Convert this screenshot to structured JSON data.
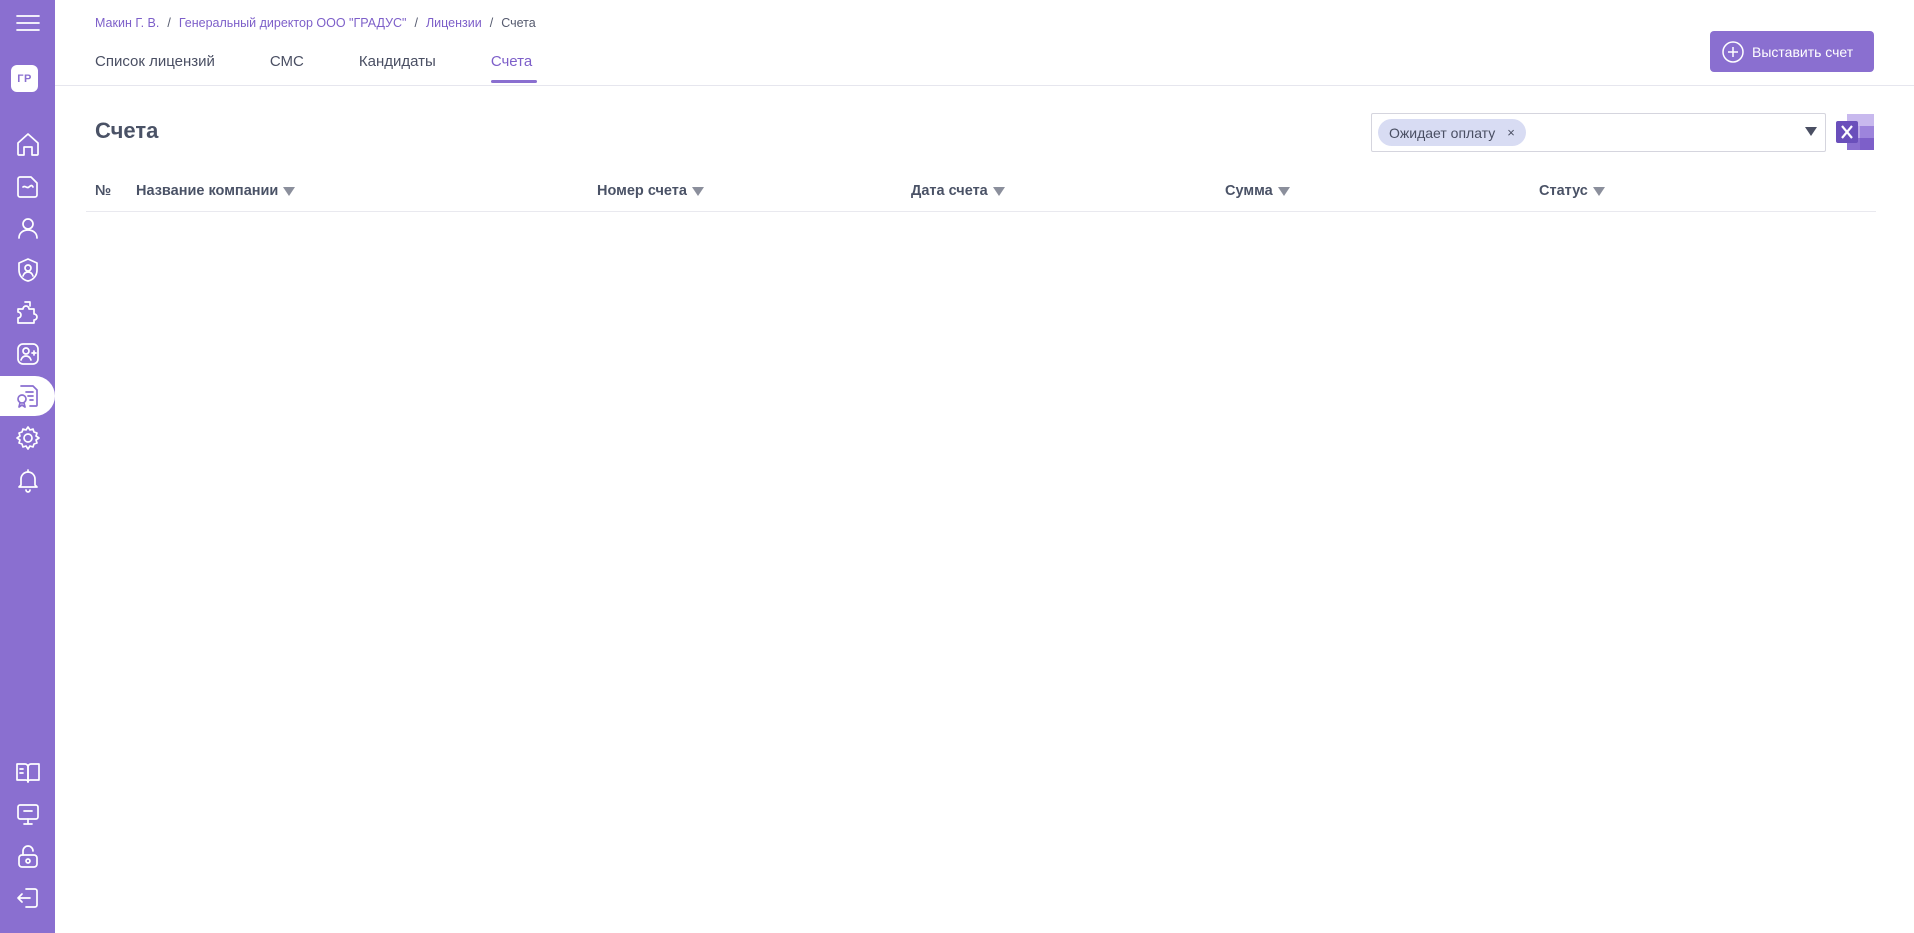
{
  "sidebar": {
    "avatar": "ГР",
    "top_items": [
      {
        "icon": "home-icon"
      },
      {
        "icon": "document-icon"
      },
      {
        "icon": "user-icon"
      },
      {
        "icon": "user-shield-icon"
      },
      {
        "icon": "puzzle-icon"
      },
      {
        "icon": "user-add-icon"
      },
      {
        "icon": "license-icon",
        "active": true
      },
      {
        "icon": "gear-icon"
      },
      {
        "icon": "bell-icon"
      }
    ],
    "bottom_items": [
      {
        "icon": "book-icon"
      },
      {
        "icon": "monitor-chat-icon"
      },
      {
        "icon": "unlock-icon"
      },
      {
        "icon": "logout-icon"
      }
    ]
  },
  "breadcrumb": {
    "items": [
      "Макин Г. В.",
      "Генеральный директор ООО \"ГРАДУС\"",
      "Лицензии",
      "Счета"
    ]
  },
  "tabs": [
    "Список лицензий",
    "СМС",
    "Кандидаты",
    "Счета"
  ],
  "active_tab": "Счета",
  "header": {
    "create_button_label": "Выставить счет"
  },
  "main": {
    "title": "Счета",
    "filter": {
      "selected_chip": "Ожидает оплату",
      "chip_remove": "×"
    },
    "export_icon": "excel-icon",
    "table": {
      "columns": [
        "№",
        "Название компании",
        "Номер счета",
        "Дата счета",
        "Сумма",
        "Статус"
      ],
      "rows": []
    }
  },
  "colors": {
    "accent": "#8a6fd0",
    "link": "#7d5fc9",
    "chip_bg": "#d8dcf3"
  }
}
